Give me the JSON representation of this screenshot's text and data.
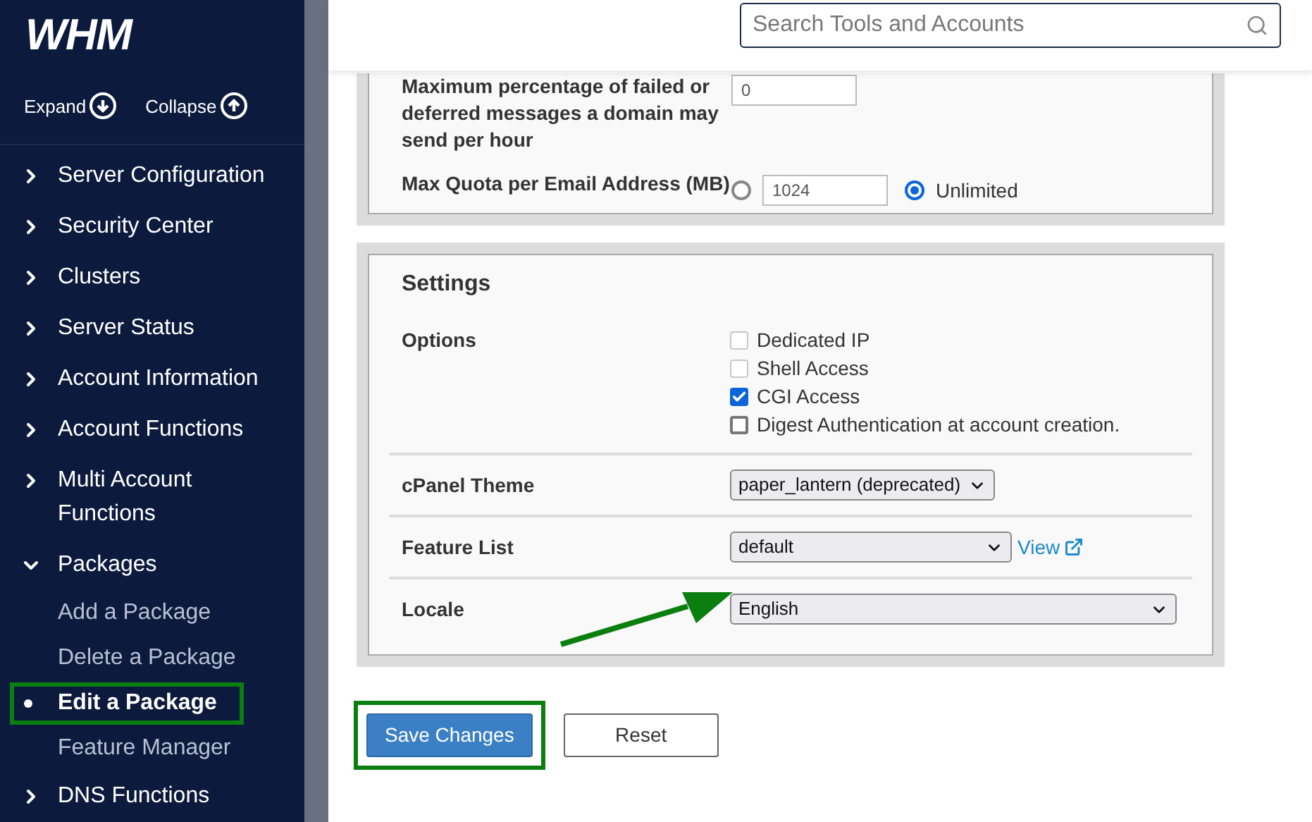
{
  "sidebar": {
    "logo": "WHM",
    "expand": "Expand",
    "collapse": "Collapse",
    "items": [
      {
        "label": "Server Configuration",
        "expanded": false
      },
      {
        "label": "Security Center",
        "expanded": false
      },
      {
        "label": "Clusters",
        "expanded": false
      },
      {
        "label": "Server Status",
        "expanded": false
      },
      {
        "label": "Account Information",
        "expanded": false
      },
      {
        "label": "Account Functions",
        "expanded": false
      },
      {
        "label": "Multi Account Functions",
        "expanded": false
      },
      {
        "label": "Packages",
        "expanded": true,
        "children": [
          {
            "label": "Add a Package",
            "selected": false,
            "highlighted": false
          },
          {
            "label": "Delete a Package",
            "selected": false,
            "highlighted": false
          },
          {
            "label": "Edit a Package",
            "selected": true,
            "highlighted": true
          },
          {
            "label": "Feature Manager",
            "selected": false,
            "highlighted": false
          }
        ]
      },
      {
        "label": "DNS Functions",
        "expanded": false
      }
    ]
  },
  "search": {
    "placeholder": "Search Tools and Accounts"
  },
  "limits_panel": {
    "rows": [
      {
        "kind": "text",
        "label": "Maximum percentage of failed or deferred messages a domain may send per hour",
        "value": "0"
      },
      {
        "kind": "quota",
        "label": "Max Quota per Email Address (MB)",
        "options": [
          {
            "kind": "input",
            "value": "1024",
            "selected": false
          },
          {
            "kind": "label",
            "label": "Unlimited",
            "selected": true
          }
        ]
      }
    ]
  },
  "settings_panel": {
    "title": "Settings",
    "rows": [
      {
        "kind": "checkboxes",
        "label": "Options",
        "items": [
          {
            "label": "Dedicated IP",
            "checked": false,
            "disabled": true
          },
          {
            "label": "Shell Access",
            "checked": false,
            "disabled": true
          },
          {
            "label": "CGI Access",
            "checked": true,
            "disabled": false
          },
          {
            "label": "Digest Authentication at account creation.",
            "checked": false,
            "disabled": false
          }
        ]
      },
      {
        "kind": "select",
        "label": "cPanel Theme",
        "value": "paper_lantern (deprecated)"
      },
      {
        "kind": "select",
        "label": "Feature List",
        "value": "default",
        "link": "View"
      },
      {
        "kind": "select",
        "label": "Locale",
        "value": "English"
      }
    ]
  },
  "buttons": [
    {
      "kind": "primary",
      "label": "Save Changes",
      "highlighted": true
    },
    {
      "kind": "secondary",
      "label": "Reset",
      "highlighted": false
    }
  ]
}
